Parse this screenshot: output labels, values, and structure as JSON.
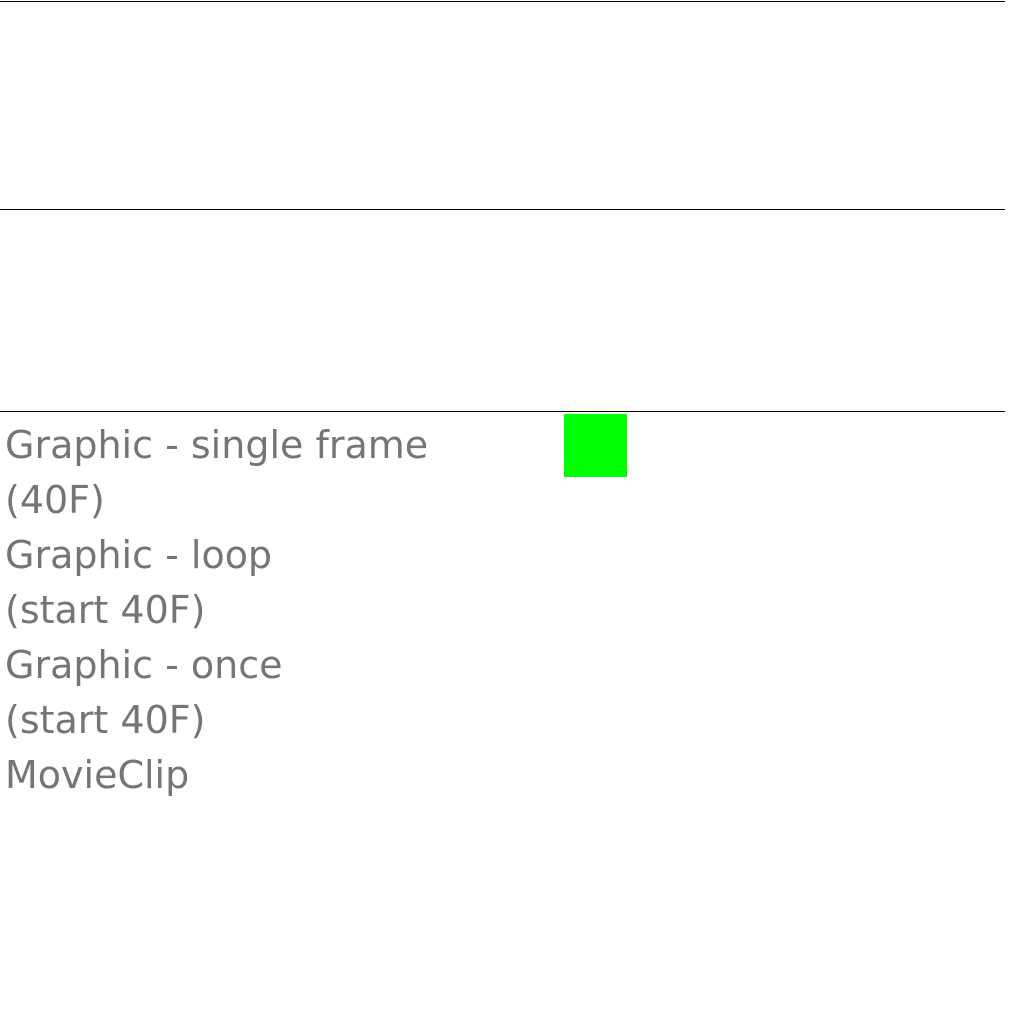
{
  "colors": {
    "text": "#757575",
    "rule": "#000000",
    "swatch": "#00ff00",
    "background": "#ffffff"
  },
  "items": [
    {
      "line1": "Graphic - single frame",
      "line2": "(40F)"
    },
    {
      "line1": "Graphic - loop",
      "line2": "(start 40F)"
    },
    {
      "line1": "Graphic - once",
      "line2": "(start 40F)"
    },
    {
      "line1": "MovieClip",
      "line2": ""
    }
  ]
}
